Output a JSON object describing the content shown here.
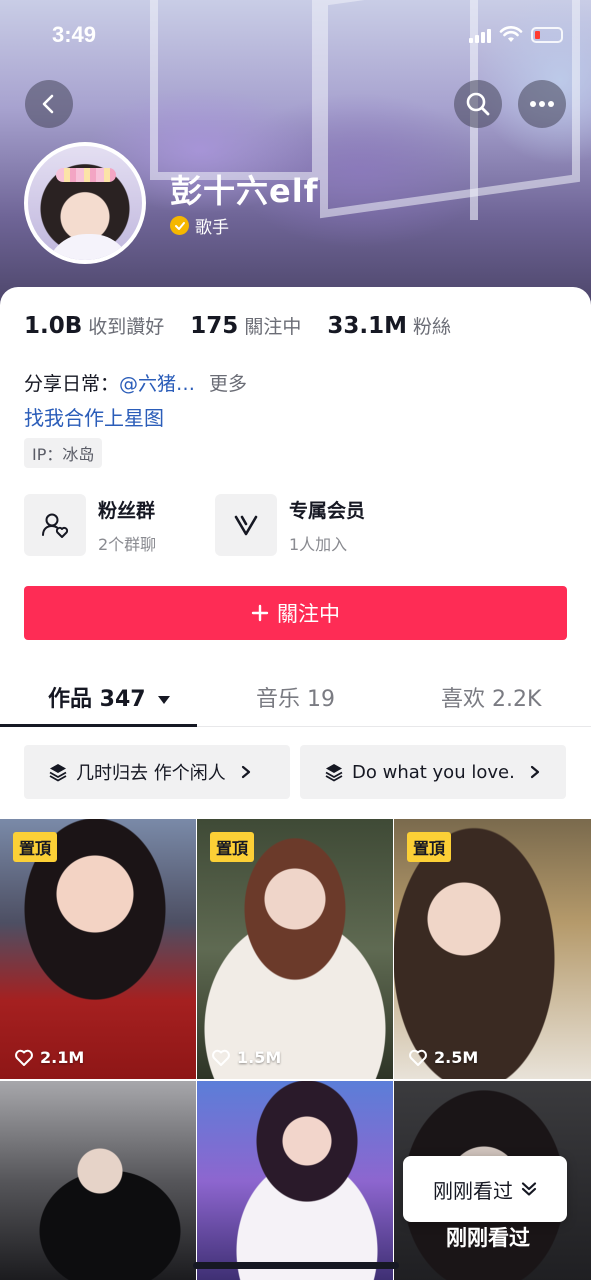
{
  "status_bar": {
    "time": "3:49"
  },
  "profile": {
    "name": "彭十六elf",
    "verified_title": "歌手",
    "stats": [
      {
        "value": "1.0B",
        "label": "收到讚好"
      },
      {
        "value": "175",
        "label": "關注中"
      },
      {
        "value": "33.1M",
        "label": "粉絲"
      }
    ],
    "bio_prefix": "分享日常：",
    "bio_mention": "@六猪…",
    "bio_more": "更多",
    "bio_link": "找我合作上星图",
    "ip_location": "IP：冰岛"
  },
  "features": [
    {
      "title": "粉丝群",
      "subtitle": "2个群聊",
      "icon": "fan-group-icon"
    },
    {
      "title": "专属会员",
      "subtitle": "1人加入",
      "icon": "membership-v-icon"
    }
  ],
  "follow_button": {
    "label": "關注中",
    "color": "#fe2c55"
  },
  "tabs": [
    {
      "label": "作品 347"
    },
    {
      "label": "音乐 19"
    },
    {
      "label": "喜欢 2.2K"
    }
  ],
  "collections": [
    {
      "label": "几时归去 作个闲人"
    },
    {
      "label": "Do what you love."
    }
  ],
  "videos": [
    {
      "pinned": "置頂",
      "likes": "2.1M"
    },
    {
      "pinned": "置頂",
      "likes": "1.5M"
    },
    {
      "pinned": "置頂",
      "likes": "2.5M"
    },
    {},
    {},
    {}
  ],
  "recent_popup": {
    "label": "刚刚看过"
  },
  "recent_overlay_label": "刚刚看过",
  "colors": {
    "accent": "#fe2c55",
    "link": "#2b5db9",
    "pin_badge": "#fcd036"
  }
}
